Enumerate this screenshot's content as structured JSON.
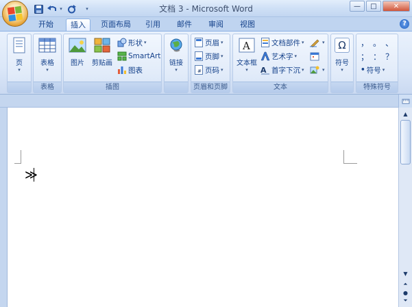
{
  "window": {
    "title": "文档 3 - Microsoft Word",
    "minimize_glyph": "—",
    "maximize_glyph": "□",
    "close_glyph": "✕"
  },
  "qat": {
    "save_glyph": "💾",
    "undo_glyph": "↶",
    "redo_glyph": "↻",
    "customize_glyph": "▾"
  },
  "tabs": [
    {
      "label": "开始",
      "active": false
    },
    {
      "label": "插入",
      "active": true
    },
    {
      "label": "页面布局",
      "active": false
    },
    {
      "label": "引用",
      "active": false
    },
    {
      "label": "邮件",
      "active": false
    },
    {
      "label": "审阅",
      "active": false
    },
    {
      "label": "视图",
      "active": false
    }
  ],
  "help_glyph": "?",
  "ribbon": {
    "groups": {
      "pages": {
        "label": "",
        "page_button": "页"
      },
      "tables": {
        "label": "表格",
        "table_button": "表格"
      },
      "illustrations": {
        "label": "插图",
        "picture": "图片",
        "clipart": "剪贴画",
        "shapes": "形状",
        "smartart": "SmartArt",
        "chart": "图表"
      },
      "links": {
        "label": "",
        "link_button": "链接"
      },
      "header_footer": {
        "label": "页眉和页脚",
        "header": "页眉",
        "footer": "页脚",
        "page_number": "页码"
      },
      "text": {
        "label": "文本",
        "textbox": "文本框",
        "quick_parts": "文档部件",
        "wordart": "艺术字",
        "dropcap": "首字下沉"
      },
      "symbols": {
        "label": "",
        "symbol": "符号",
        "symbol_glyph": "Ω"
      },
      "special": {
        "label": "特殊符号",
        "symbols": [
          "，",
          "。",
          "、",
          "；",
          "：",
          "？"
        ],
        "more": "符号"
      }
    }
  },
  "document": {
    "text": "≫"
  },
  "colors": {
    "ribbon_bg": "#dbe7f8",
    "text": "#15428b",
    "workspace": "#c4d6ef"
  }
}
